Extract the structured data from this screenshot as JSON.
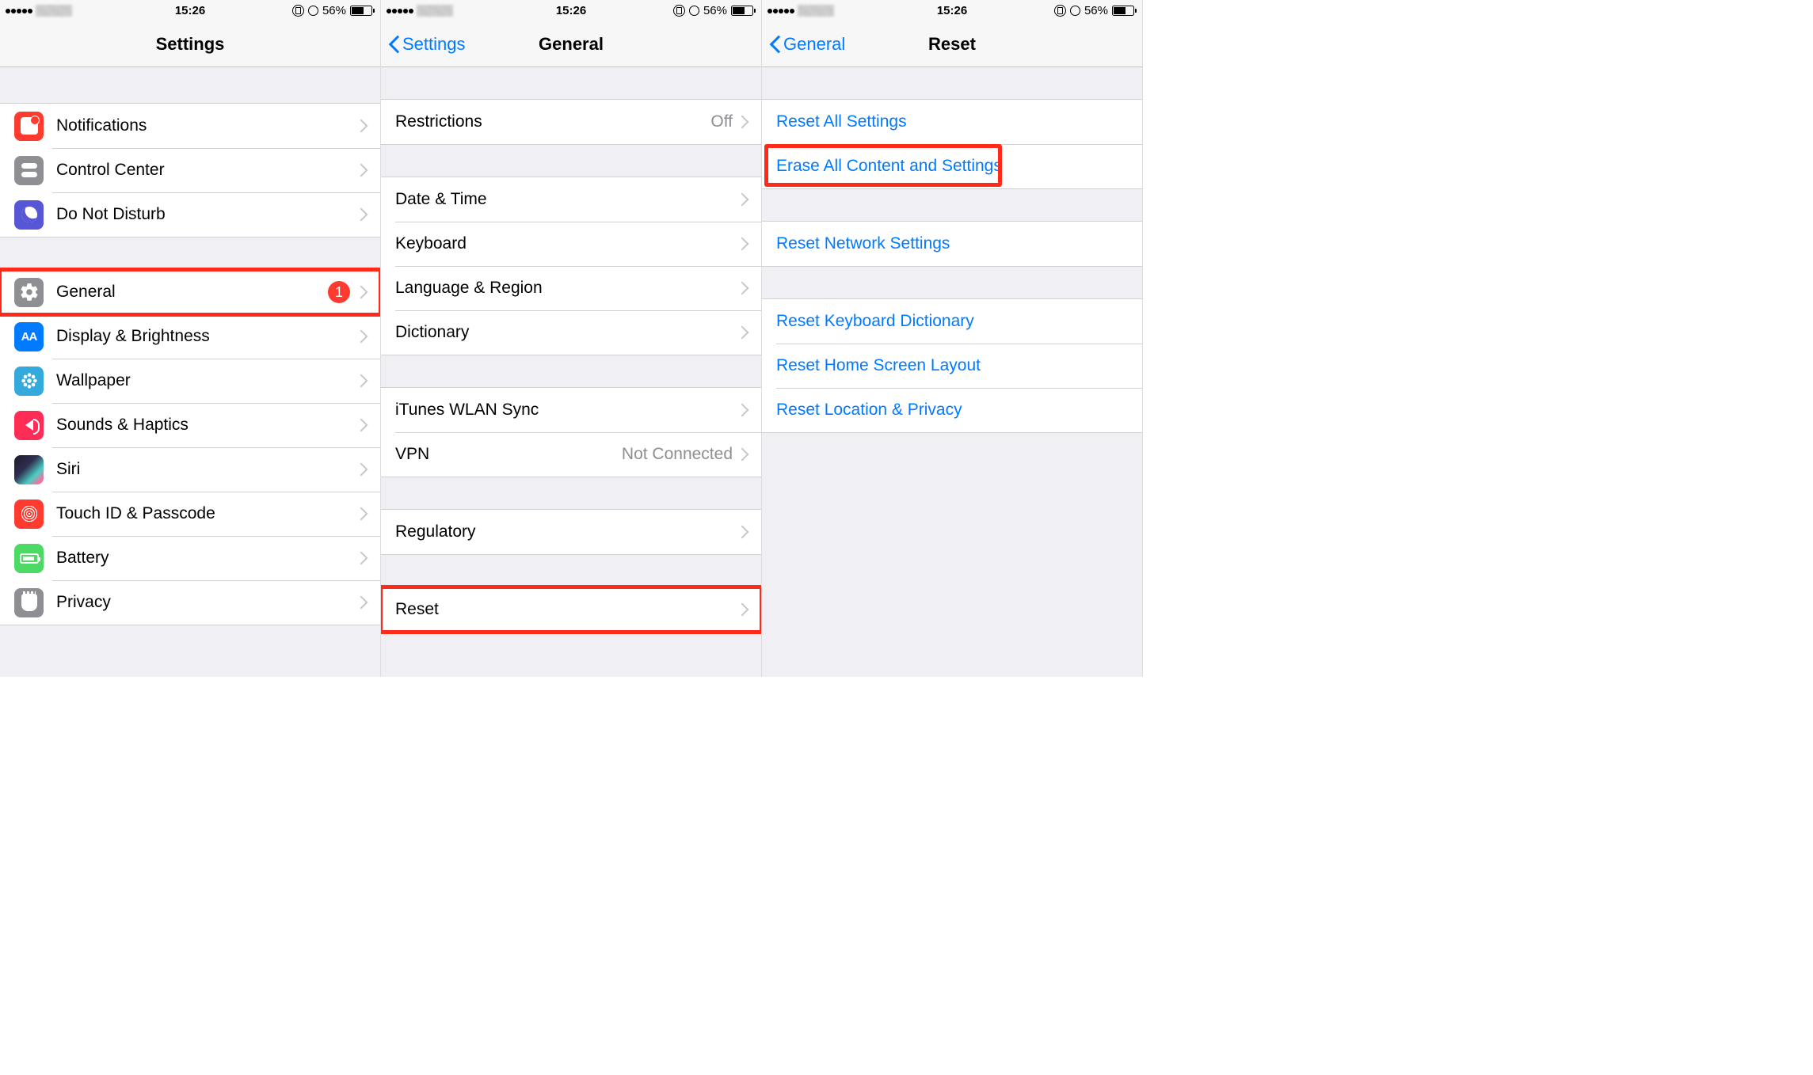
{
  "status": {
    "time": "15:26",
    "battery_pct": "56%"
  },
  "screen1": {
    "title": "Settings",
    "general_badge": "1",
    "rows": {
      "notifications": "Notifications",
      "control_center": "Control Center",
      "dnd": "Do Not Disturb",
      "general": "General",
      "display": "Display & Brightness",
      "wallpaper": "Wallpaper",
      "sounds": "Sounds & Haptics",
      "siri": "Siri",
      "touchid": "Touch ID & Passcode",
      "battery": "Battery",
      "privacy": "Privacy"
    }
  },
  "screen2": {
    "back": "Settings",
    "title": "General",
    "restrictions": {
      "label": "Restrictions",
      "value": "Off"
    },
    "date_time": "Date & Time",
    "keyboard": "Keyboard",
    "language": "Language & Region",
    "dictionary": "Dictionary",
    "itunes": "iTunes WLAN Sync",
    "vpn": {
      "label": "VPN",
      "value": "Not Connected"
    },
    "regulatory": "Regulatory",
    "reset": "Reset"
  },
  "screen3": {
    "back": "General",
    "title": "Reset",
    "reset_all": "Reset All Settings",
    "erase_all": "Erase All Content and Settings",
    "reset_network": "Reset Network Settings",
    "reset_keyboard": "Reset Keyboard Dictionary",
    "reset_home": "Reset Home Screen Layout",
    "reset_location": "Reset Location & Privacy"
  }
}
